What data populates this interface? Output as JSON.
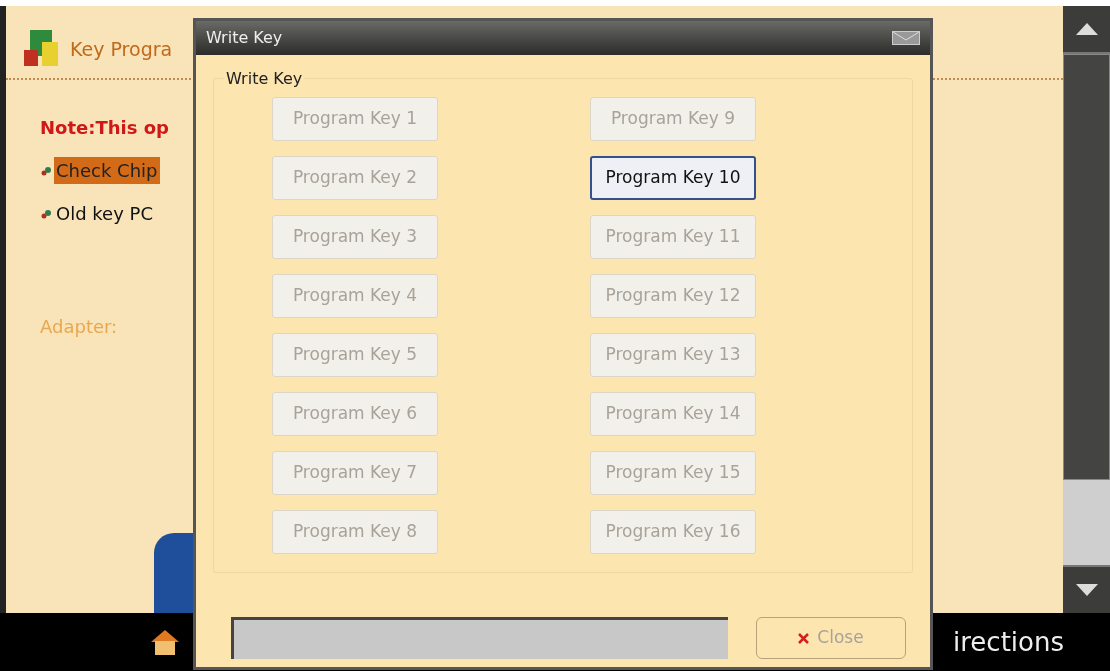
{
  "page": {
    "title": "Key Progra",
    "note": "Note:This op",
    "options": [
      {
        "label": "Check Chip",
        "selected": true
      },
      {
        "label": "Old key PC",
        "selected": false
      }
    ],
    "adapter_label": "Adapter:"
  },
  "bottom_bar": {
    "right_label": "irections"
  },
  "dialog": {
    "title": "Write Key",
    "group_title": "Write Key",
    "keys": [
      {
        "label": "Program Key 1",
        "selected": false
      },
      {
        "label": "Program Key 2",
        "selected": false
      },
      {
        "label": "Program Key 3",
        "selected": false
      },
      {
        "label": "Program Key 4",
        "selected": false
      },
      {
        "label": "Program Key 5",
        "selected": false
      },
      {
        "label": "Program Key 6",
        "selected": false
      },
      {
        "label": "Program Key 7",
        "selected": false
      },
      {
        "label": "Program Key 8",
        "selected": false
      },
      {
        "label": "Program Key 9",
        "selected": false
      },
      {
        "label": "Program Key 10",
        "selected": true
      },
      {
        "label": "Program Key 11",
        "selected": false
      },
      {
        "label": "Program Key 12",
        "selected": false
      },
      {
        "label": "Program Key 13",
        "selected": false
      },
      {
        "label": "Program Key 14",
        "selected": false
      },
      {
        "label": "Program Key 15",
        "selected": false
      },
      {
        "label": "Program Key 16",
        "selected": false
      }
    ],
    "close_button": "Close"
  }
}
